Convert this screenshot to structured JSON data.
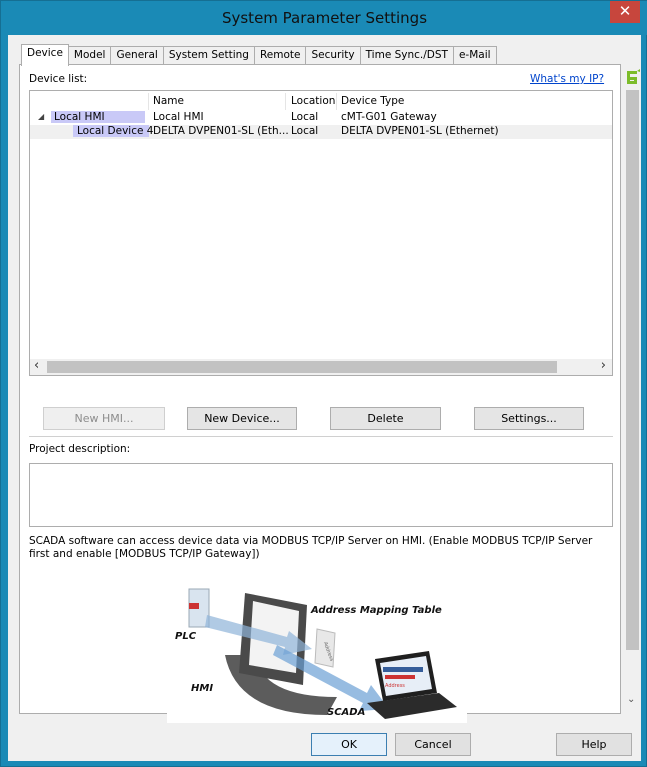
{
  "window": {
    "title": "System Parameter Settings",
    "close_glyph": "✕"
  },
  "tabs": [
    {
      "label": "Device",
      "active": true
    },
    {
      "label": "Model"
    },
    {
      "label": "General"
    },
    {
      "label": "System Setting"
    },
    {
      "label": "Remote"
    },
    {
      "label": "Security"
    },
    {
      "label": "Time Sync./DST"
    },
    {
      "label": "e-Mail"
    }
  ],
  "device_panel": {
    "list_label": "Device list:",
    "whats_my_ip": "What's my IP?",
    "columns": [
      "Name",
      "Location",
      "Device Type"
    ],
    "rows": [
      {
        "tree": "Local HMI",
        "name": "Local HMI",
        "location": "Local",
        "type": "cMT-G01 Gateway",
        "expander": "◢"
      },
      {
        "tree": "Local Device 4",
        "name": "DELTA DVPEN01-SL (Eth...",
        "location": "Local",
        "type": "DELTA DVPEN01-SL (Ethernet)"
      }
    ],
    "scroll_left": "‹",
    "scroll_right": "›",
    "buttons": {
      "new_hmi": "New HMI...",
      "new_device": "New Device...",
      "delete": "Delete",
      "settings": "Settings..."
    },
    "project_description_label": "Project description:",
    "project_description_value": "",
    "scada_note": "SCADA software can access device data via MODBUS TCP/IP Server on HMI. (Enable MODBUS TCP/IP Server first and enable [MODBUS TCP/IP Gateway])",
    "diagram": {
      "plc": "PLC",
      "hmi": "HMI",
      "scada": "SCADA",
      "address_mapping": "Address Mapping Table",
      "address_tag": "Address",
      "screen_text": "Address"
    }
  },
  "vscroll": {
    "down": "⌄"
  },
  "footer": {
    "ok": "OK",
    "cancel": "Cancel",
    "help": "Help"
  },
  "colors": {
    "titlebar": "#1a8ab6",
    "close": "#c7463d",
    "selection": "#c9c9f7",
    "logo_green": "#7cbc2a"
  }
}
